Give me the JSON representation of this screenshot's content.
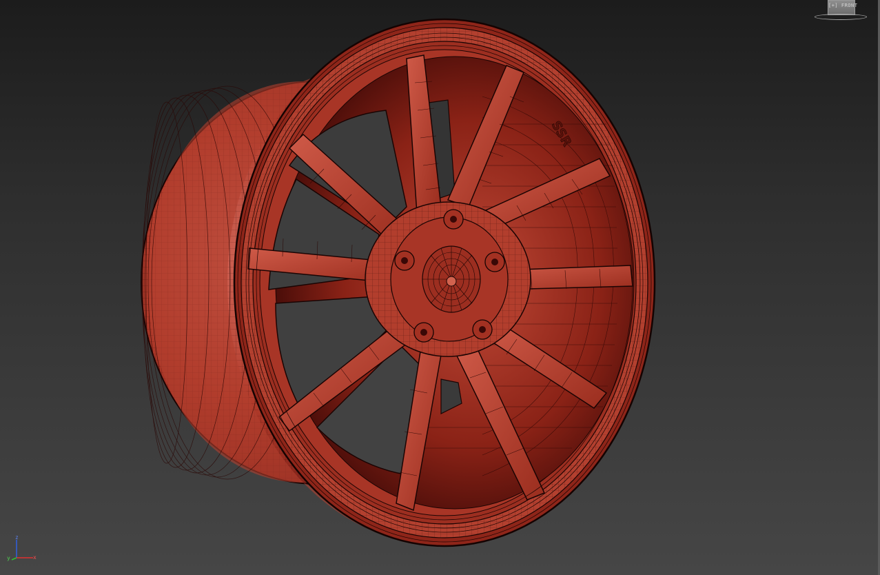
{
  "viewport": {
    "viewcube_label": "[+] FRONT",
    "axis": {
      "x": "x",
      "y": "y",
      "z": "z"
    },
    "brand_text": "SSR"
  },
  "colors": {
    "mesh_fill": "#b8412f",
    "mesh_dark": "#3a0806",
    "wire": "#1a0403",
    "background_top": "#1c1c1c",
    "background_bottom": "#464646",
    "axis_x": "#e03030",
    "axis_y": "#30c030",
    "axis_z": "#3060e0"
  }
}
